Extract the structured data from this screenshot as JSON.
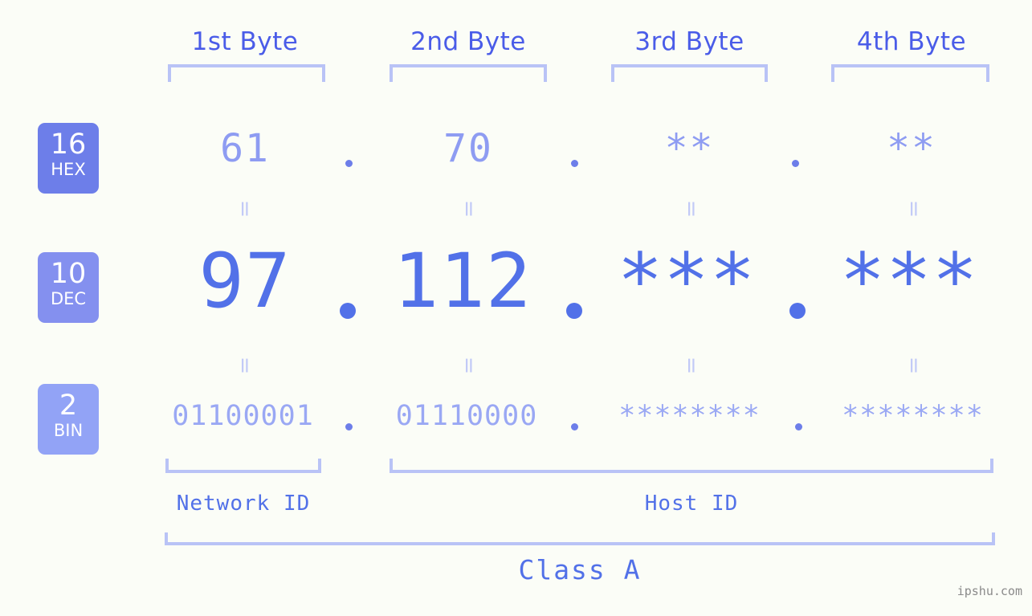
{
  "meta": {
    "watermark": "ipshu.com",
    "background_color": "#fbfdf7",
    "accent_color": "#5271e8",
    "accent_light": "#9aa8f4",
    "bracket_color": "#b9c3f6"
  },
  "headers": {
    "byte1": "1st Byte",
    "byte2": "2nd Byte",
    "byte3": "3rd Byte",
    "byte4": "4th Byte"
  },
  "bases": [
    {
      "num": "16",
      "abbr": "HEX",
      "color": "#6d7ee9"
    },
    {
      "num": "10",
      "abbr": "DEC",
      "color": "#8490ef"
    },
    {
      "num": "2",
      "abbr": "BIN",
      "color": "#92a3f6"
    }
  ],
  "rows": {
    "hex": {
      "b1": "61",
      "b2": "70",
      "b3": "**",
      "b4": "**"
    },
    "dec": {
      "b1": "97",
      "b2": "112",
      "b3": "***",
      "b4": "***"
    },
    "bin": {
      "b1": "01100001",
      "b2": "01110000",
      "b3": "********",
      "b4": "********"
    }
  },
  "separator": {
    "dot": ".",
    "equals": "="
  },
  "footer": {
    "network_id": "Network ID",
    "host_id": "Host ID",
    "class": "Class A"
  }
}
